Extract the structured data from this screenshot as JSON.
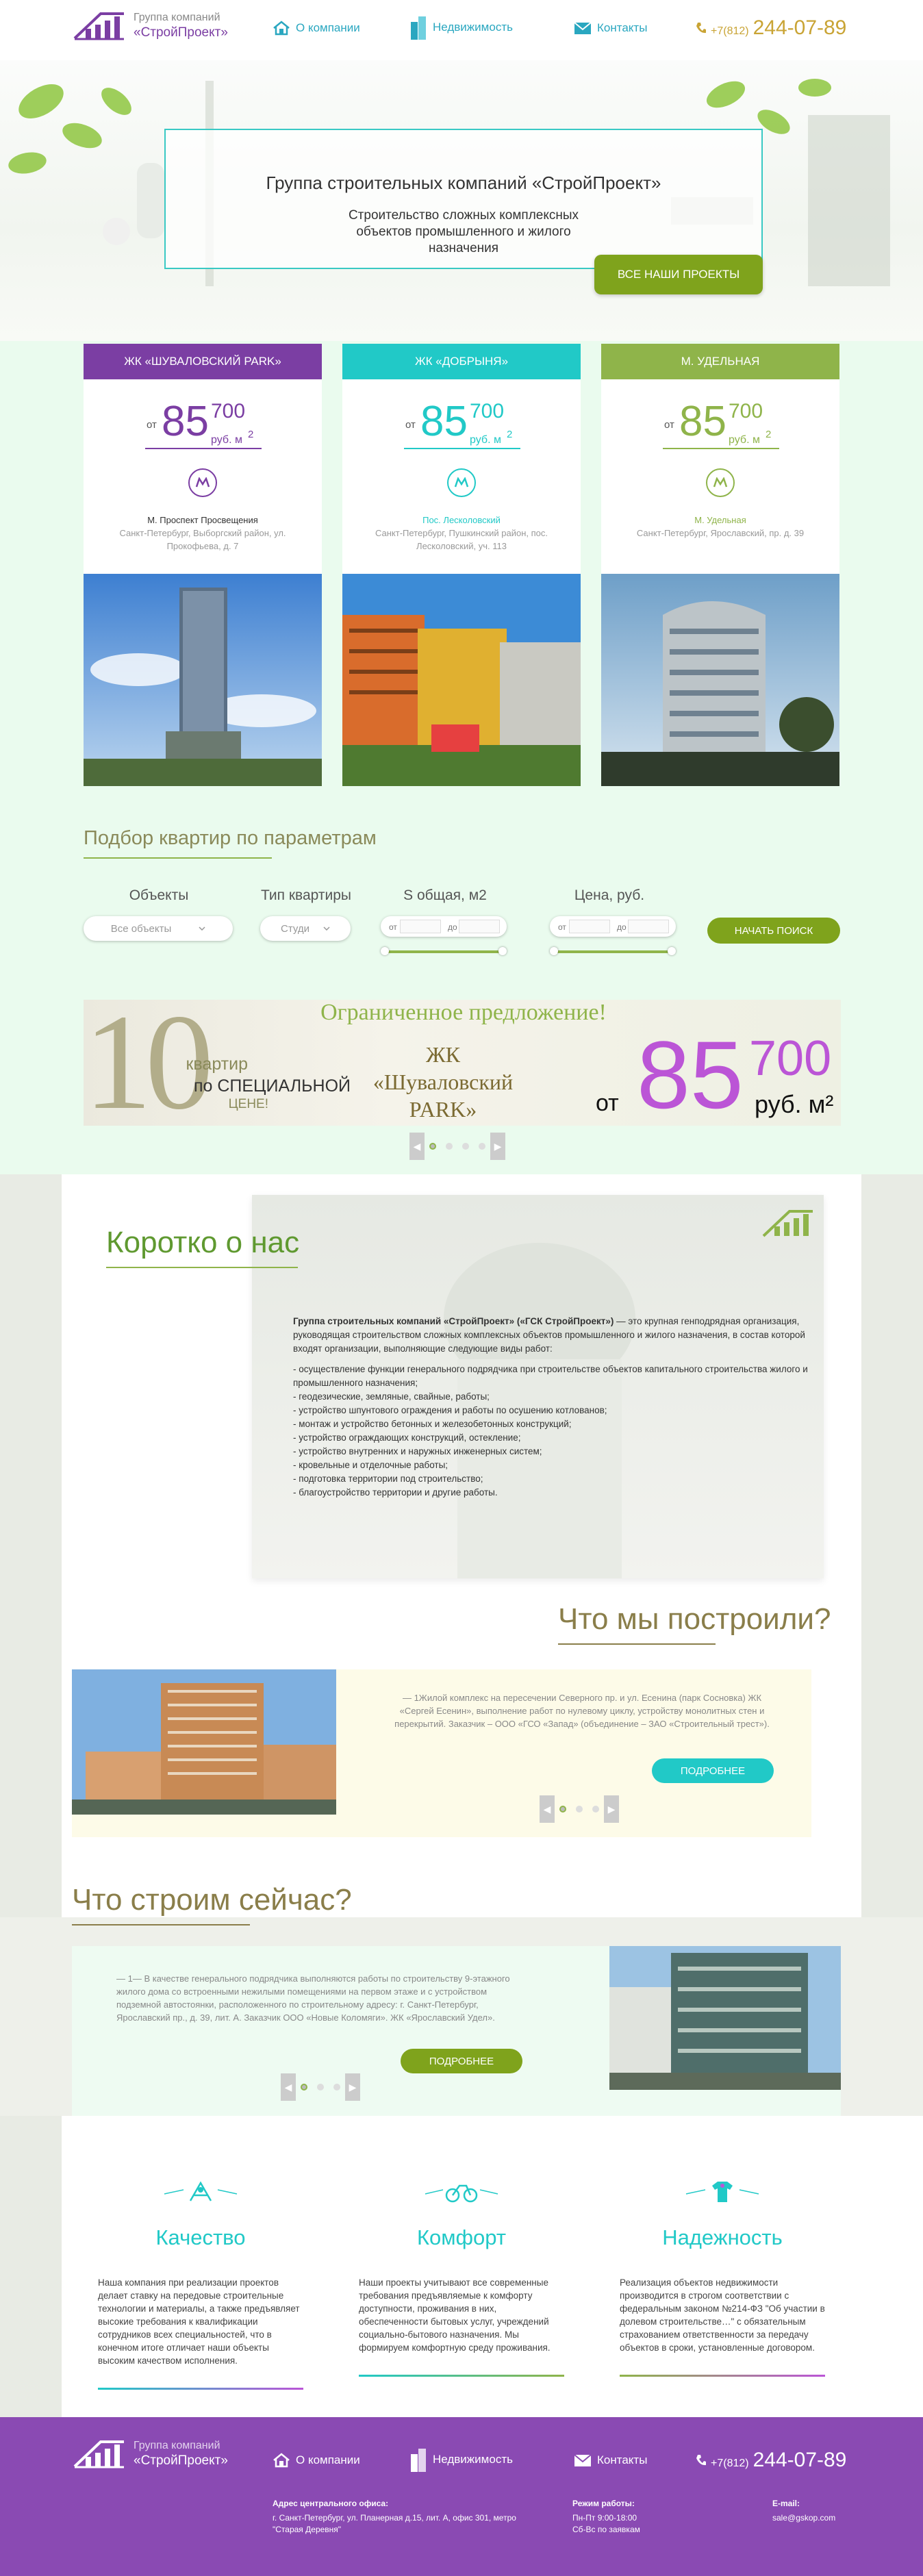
{
  "header": {
    "logo_sub": "Группа компаний",
    "logo_main": "«СтройПроект»",
    "nav": [
      {
        "label": "О компании",
        "icon": "house-icon"
      },
      {
        "label": "Недвижимость",
        "icon": "buildings-icon"
      },
      {
        "label": "Контакты",
        "icon": "mail-icon"
      }
    ],
    "phone_code": "+7(812)",
    "phone_num": "244-07-89"
  },
  "hero": {
    "title": "Группа строительных компаний «СтройПроект»",
    "subtitle": "Строительство сложных комплексных объектов промышленного и жилого назначения",
    "button": "ВСЕ НАШИ ПРОЕКТЫ"
  },
  "projects": [
    {
      "name": "ЖК «ШУВАЛОВСКИЙ PARK»",
      "color": "#7b3ea3",
      "ot": "от",
      "price": "85",
      "kop": "700",
      "unit": "руб. м",
      "sup": "2",
      "metro": "М. Проспект Просвещения",
      "address": "Санкт-Петербург, Выборгский район, ул. Прокофьева, д. 7"
    },
    {
      "name": "ЖК «ДОБРЫНЯ»",
      "color": "#21c9c7",
      "ot": "от",
      "price": "85",
      "kop": "700",
      "unit": "руб. м",
      "sup": "2",
      "metro": "Пос. Лесколовский",
      "address": "Санкт-Петербург, Пушкинский район, пос. Лесколовский, уч. 113"
    },
    {
      "name": "М. УДЕЛЬНАЯ",
      "color": "#8fb44a",
      "ot": "от",
      "price": "85",
      "kop": "700",
      "unit": "руб. м",
      "sup": "2",
      "metro": "М. Удельная",
      "address": "Санкт-Петербург, Ярославский, пр. д. 39"
    }
  ],
  "filter": {
    "title": "Подбор квартир по параметрам",
    "labels": [
      "Объекты",
      "Тип квартиры",
      "S общая, м2",
      "Цена, руб."
    ],
    "objects_value": "Все объекты",
    "type_value": "Студи",
    "from": "от",
    "to": "до",
    "search": "НАЧАТЬ ПОИСК"
  },
  "banner": {
    "headline": "Ограниченное предложение!",
    "count": "10",
    "count_text1": "квартир",
    "count_text2": "по СПЕЦИАЛЬНОЙ",
    "count_text3": "ЦЕНЕ!",
    "complex": "ЖК «Шуваловский PARK»",
    "ot": "от",
    "price": "85",
    "kop": "700",
    "unit": "руб. м²"
  },
  "about": {
    "title": "Коротко о нас",
    "intro_bold": "Группа строительных компаний «СтройПроект» («ГСК СтройПроект»)",
    "intro_rest": " — это крупная генподрядная организация, руководящая строительством сложных комплексных объектов промышленного и жилого назначения, в состав которой входят организации, выполняющие следующие виды работ:",
    "items": [
      "- осуществление функции генерального подрядчика при строительстве объектов капитального строительства жилого и промышленного назначения;",
      "- геодезические, земляные, свайные, работы;",
      "- устройство шпунтового ограждения и работы по осушению котлованов;",
      "- монтаж и устройство бетонных и железобетонных конструкций;",
      "- устройство ограждающих конструкций, остекление;",
      "- устройство внутренних и наружных инженерных систем;",
      "- кровельные и отделочные работы;",
      "- подготовка территории под строительство;",
      "- благоустройство территории и другие работы."
    ]
  },
  "built": {
    "title": "Что мы построили?",
    "text": "— 1Жилой комплекс на пересечении Северного пр. и ул. Есенина (парк Сосновка) ЖК «Сергей Есенин», выполнение работ по нулевому циклу, устройству монолитных стен и перекрытий. Заказчик – ООО «ГСО «Запад» (объединение – ЗАО «Строительный трест»).",
    "button": "ПОДРОБНЕЕ"
  },
  "now": {
    "title": "Что строим сейчас?",
    "text": "— 1— В качестве генерального подрядчика выполняются работы по строительству 9-этажного жилого дома со встроенными нежилыми помещениями на первом этаже и с устройством подземной автостоянки, расположенного по строительному адресу: г. Санкт-Петербург, Ярославский пр., д. 39, лит. А. Заказчик ООО «Новые Коломяги». ЖК «Ярославский Удел».",
    "button": "ПОДРОБНЕЕ"
  },
  "features": [
    {
      "title": "Качество",
      "icon": "people-icon",
      "color": "#21c9c7",
      "text": "Наша компания при реализации проектов делает ставку на передовые строительные технологии и материалы, а также предъявляет высокие требования к квалификации сотрудников всех специальностей, что в конечном итоге отличает наши объекты высоким качеством исполнения."
    },
    {
      "title": "Комфорт",
      "icon": "bicycle-icon",
      "color": "#21c9c7",
      "text": "Наши проекты учитывают все современные требования предъявляемые к комфорту доступности, проживания в них, обеспеченности бытовых услуг, учреждений социально-бытового назначения. Мы формируем комфортную среду проживания."
    },
    {
      "title": "Надежность",
      "icon": "shirt-icon",
      "color": "#21c9c7",
      "text": "Реализация объектов недвижимости производится в строгом соответствии с федеральным законом №214-ФЗ \"Об участии в долевом строительстве…\" с обязательным страхованием ответственности за передачу объектов в сроки, установленные договором."
    }
  ],
  "footer": {
    "addr_title": "Адрес центрального офиса:",
    "addr": "г. Санкт-Петербург, ул. Планерная д.15, лит. А, офис 301, метро \"Старая Деревня\"",
    "hours_title": "Режим работы:",
    "hours1": "Пн-Пт 9:00-18:00",
    "hours2": "Сб-Вс по заявкам",
    "email_title": "E-mail:",
    "email": "sale@gskop.com"
  }
}
